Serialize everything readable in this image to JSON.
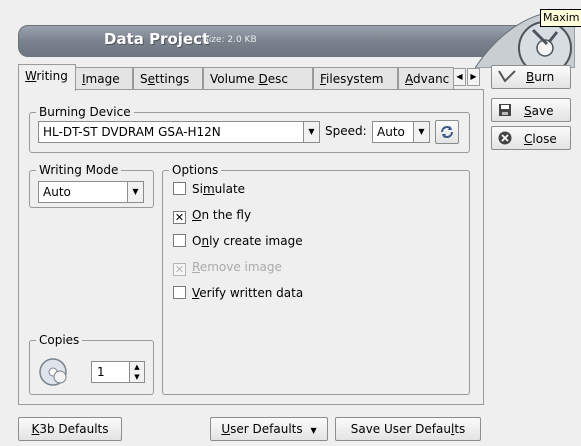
{
  "header": {
    "title": "Data Project",
    "size_label": "Size: 2.0 KB",
    "tooltip": "Maxim"
  },
  "tabs": {
    "writing": {
      "pre": "",
      "mn": "W",
      "post": "riting"
    },
    "image": {
      "pre": "",
      "mn": "I",
      "post": "mage"
    },
    "settings": {
      "pre": "S",
      "mn": "e",
      "post": "ttings"
    },
    "volume_desc": {
      "pre": "Volume ",
      "mn": "D",
      "post": "esc"
    },
    "filesystem": {
      "pre": "",
      "mn": "F",
      "post": "ilesystem"
    },
    "advanced": {
      "pre": "",
      "mn": "A",
      "post": "dvanc"
    },
    "scroll_left": "◀",
    "scroll_right": "▶"
  },
  "burning_device": {
    "title": "Burning Device",
    "device": "HL-DT-ST DVDRAM GSA-H12N",
    "speed_label": "Speed:",
    "speed_value": "Auto"
  },
  "writing_mode": {
    "title": "Writing Mode",
    "value": "Auto"
  },
  "options": {
    "title": "Options",
    "simulate": {
      "pre": "Si",
      "mn": "m",
      "post": "ulate",
      "checked": false
    },
    "on_the_fly": {
      "pre": "",
      "mn": "O",
      "post": "n the fly",
      "checked": true
    },
    "only_create_image": {
      "pre": "O",
      "mn": "n",
      "post": "ly create image",
      "checked": false
    },
    "remove_image": {
      "pre": "",
      "mn": "R",
      "post": "emove image",
      "checked": true,
      "enabled": false
    },
    "verify_written_data": {
      "pre": "",
      "mn": "V",
      "post": "erify written data",
      "checked": false
    }
  },
  "copies": {
    "title": "Copies",
    "value": "1"
  },
  "side_buttons": {
    "burn": {
      "pre": "",
      "mn": "B",
      "post": "urn"
    },
    "save": {
      "pre": "",
      "mn": "S",
      "post": "ave"
    },
    "close": {
      "pre": "",
      "mn": "C",
      "post": "lose"
    }
  },
  "footer": {
    "k3b_defaults": {
      "pre": "",
      "mn": "K",
      "post": "3b Defaults"
    },
    "user_defaults": {
      "pre": "",
      "mn": "U",
      "post": "ser Defaults"
    },
    "save_user_defaults": {
      "pre": "Save User Defau",
      "mn": "l",
      "post": "ts"
    }
  },
  "check_mark": "✕",
  "colors": {
    "banner": "#7a838d",
    "window_bg": "#efefef"
  }
}
